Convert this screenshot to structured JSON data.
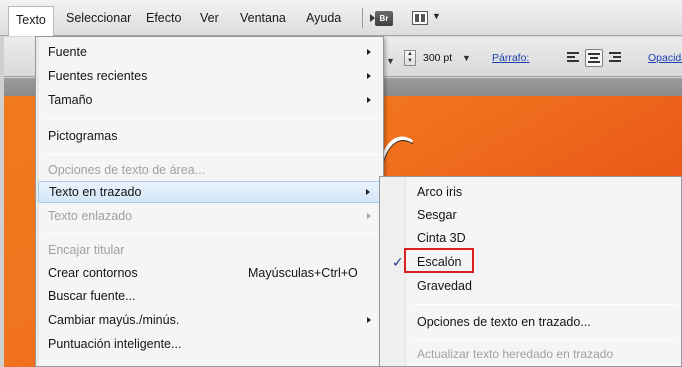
{
  "menubar": {
    "items": [
      "Texto",
      "Seleccionar",
      "Efecto",
      "Ver",
      "Ventana",
      "Ayuda"
    ],
    "bridge_icon": "Br",
    "arrange_icon": "arrange-documents-icon"
  },
  "controlbar": {
    "font_size": "300 pt",
    "parrafo_label": "Párrafo:",
    "opacidad_label": "Opacida"
  },
  "texto_menu": {
    "items": [
      {
        "label": "Fuente",
        "submenu": true,
        "disabled": false
      },
      {
        "label": "Fuentes recientes",
        "submenu": true,
        "disabled": false
      },
      {
        "label": "Tamaño",
        "submenu": true,
        "disabled": false
      },
      {
        "label": "Pictogramas",
        "submenu": false,
        "disabled": false
      },
      {
        "label": "Opciones de texto de área...",
        "submenu": false,
        "disabled": true
      },
      {
        "label": "Texto en trazado",
        "submenu": true,
        "disabled": false,
        "highlighted": true
      },
      {
        "label": "Texto enlazado",
        "submenu": true,
        "disabled": true
      },
      {
        "label": "Encajar titular",
        "submenu": false,
        "disabled": true
      },
      {
        "label": "Crear contornos",
        "shortcut": "Mayúsculas+Ctrl+O",
        "submenu": false,
        "disabled": false
      },
      {
        "label": "Buscar fuente...",
        "submenu": false,
        "disabled": false
      },
      {
        "label": "Cambiar mayús./minús.",
        "submenu": true,
        "disabled": false
      },
      {
        "label": "Puntuación inteligente...",
        "submenu": false,
        "disabled": false
      }
    ]
  },
  "texto_en_trazado_submenu": {
    "items": [
      {
        "label": "Arco iris",
        "checked": false,
        "disabled": false
      },
      {
        "label": "Sesgar",
        "checked": false,
        "disabled": false
      },
      {
        "label": "Cinta 3D",
        "checked": false,
        "disabled": false
      },
      {
        "label": "Escalón",
        "checked": true,
        "disabled": false,
        "highlighted_box": true
      },
      {
        "label": "Gravedad",
        "checked": false,
        "disabled": false
      },
      {
        "label": "Opciones de texto en trazado...",
        "checked": false,
        "disabled": false
      },
      {
        "label": "Actualizar texto heredado en trazado",
        "checked": false,
        "disabled": true
      }
    ],
    "check_glyph": "✓"
  },
  "colors": {
    "highlight_border": "#a9cbea",
    "annotation_red": "#d7201f",
    "canvas_orange": "#f07a1e"
  }
}
